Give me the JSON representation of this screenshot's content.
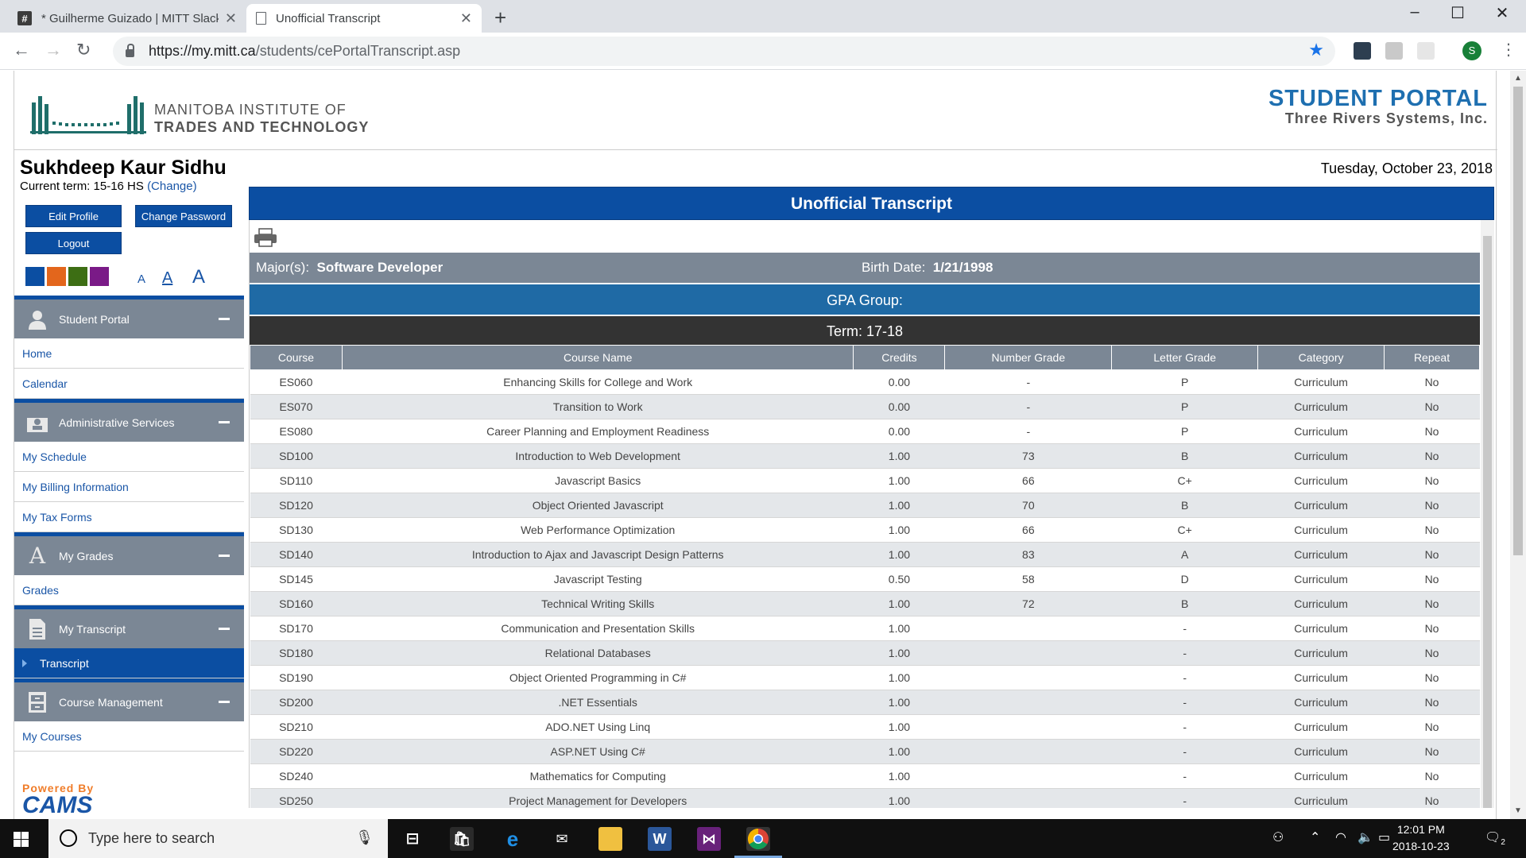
{
  "browser": {
    "tabs": [
      {
        "title": "* Guilherme Guizado | MITT Slack",
        "active": false
      },
      {
        "title": "Unofficial Transcript",
        "active": true
      }
    ],
    "url_host": "https://my.mitt.ca",
    "url_path": "/students/cePortalTranscript.asp",
    "profile_initial": "S"
  },
  "header": {
    "institute_line1": "MANITOBA INSTITUTE OF",
    "institute_line2": "TRADES AND TECHNOLOGY",
    "portal_line1": "STUDENT PORTAL",
    "portal_line2": "Three Rivers Systems, Inc."
  },
  "user": {
    "name": "Sukhdeep Kaur Sidhu",
    "term_label": "Current term: 15-16 HS",
    "change_label": "(Change)",
    "date": "Tuesday, October 23, 2018"
  },
  "buttons": {
    "edit_profile": "Edit Profile",
    "change_password": "Change Password",
    "logout": "Logout"
  },
  "theme_colors": [
    "#0b4ea2",
    "#e3661c",
    "#3d6e14",
    "#7a1a87"
  ],
  "font_sizes": [
    "A",
    "A",
    "A"
  ],
  "sidebar": {
    "sections": [
      {
        "title": "Student Portal",
        "icon": "person-icon",
        "links": [
          "Home",
          "Calendar"
        ]
      },
      {
        "title": "Administrative Services",
        "icon": "admin-icon",
        "links": [
          "My Schedule",
          "My Billing Information",
          "My Tax Forms"
        ]
      },
      {
        "title": "My Grades",
        "icon": "grades-icon",
        "links": [
          "Grades"
        ]
      },
      {
        "title": "My Transcript",
        "icon": "document-icon",
        "links": [
          "Transcript"
        ]
      },
      {
        "title": "Course Management",
        "icon": "cabinet-icon",
        "links": [
          "My Courses"
        ]
      }
    ],
    "powered_by": "Powered By",
    "cams": "CAMS"
  },
  "main": {
    "title": "Unofficial Transcript",
    "major_label": "Major(s):",
    "major_value": "Software Developer",
    "birth_label": "Birth Date:",
    "birth_value": "1/21/1998",
    "gpa_group": "GPA Group:",
    "term": "Term: 17-18",
    "columns": [
      "Course",
      "Course Name",
      "Credits",
      "Number Grade",
      "Letter Grade",
      "Category",
      "Repeat"
    ],
    "rows": [
      [
        "ES060",
        "Enhancing Skills for College and Work",
        "0.00",
        "-",
        "P",
        "Curriculum",
        "No"
      ],
      [
        "ES070",
        "Transition to Work",
        "0.00",
        "-",
        "P",
        "Curriculum",
        "No"
      ],
      [
        "ES080",
        "Career Planning and Employment Readiness",
        "0.00",
        "-",
        "P",
        "Curriculum",
        "No"
      ],
      [
        "SD100",
        "Introduction to Web Development",
        "1.00",
        "73",
        "B",
        "Curriculum",
        "No"
      ],
      [
        "SD110",
        "Javascript Basics",
        "1.00",
        "66",
        "C+",
        "Curriculum",
        "No"
      ],
      [
        "SD120",
        "Object Oriented Javascript",
        "1.00",
        "70",
        "B",
        "Curriculum",
        "No"
      ],
      [
        "SD130",
        "Web Performance Optimization",
        "1.00",
        "66",
        "C+",
        "Curriculum",
        "No"
      ],
      [
        "SD140",
        "Introduction to Ajax and Javascript Design Patterns",
        "1.00",
        "83",
        "A",
        "Curriculum",
        "No"
      ],
      [
        "SD145",
        "Javascript Testing",
        "0.50",
        "58",
        "D",
        "Curriculum",
        "No"
      ],
      [
        "SD160",
        "Technical Writing Skills",
        "1.00",
        "72",
        "B",
        "Curriculum",
        "No"
      ],
      [
        "SD170",
        "Communication and Presentation Skills",
        "1.00",
        "",
        "-",
        "Curriculum",
        "No"
      ],
      [
        "SD180",
        "Relational Databases",
        "1.00",
        "",
        "-",
        "Curriculum",
        "No"
      ],
      [
        "SD190",
        "Object Oriented Programming in C#",
        "1.00",
        "",
        "-",
        "Curriculum",
        "No"
      ],
      [
        "SD200",
        ".NET Essentials",
        "1.00",
        "",
        "-",
        "Curriculum",
        "No"
      ],
      [
        "SD210",
        "ADO.NET Using Linq",
        "1.00",
        "",
        "-",
        "Curriculum",
        "No"
      ],
      [
        "SD220",
        "ASP.NET Using C#",
        "1.00",
        "",
        "-",
        "Curriculum",
        "No"
      ],
      [
        "SD240",
        "Mathematics for Computing",
        "1.00",
        "",
        "-",
        "Curriculum",
        "No"
      ],
      [
        "SD250",
        "Project Management for Developers",
        "1.00",
        "",
        "-",
        "Curriculum",
        "No"
      ]
    ]
  },
  "taskbar": {
    "search_placeholder": "Type here to search",
    "time": "12:01 PM",
    "date": "2018-10-23",
    "notifications": "2"
  }
}
